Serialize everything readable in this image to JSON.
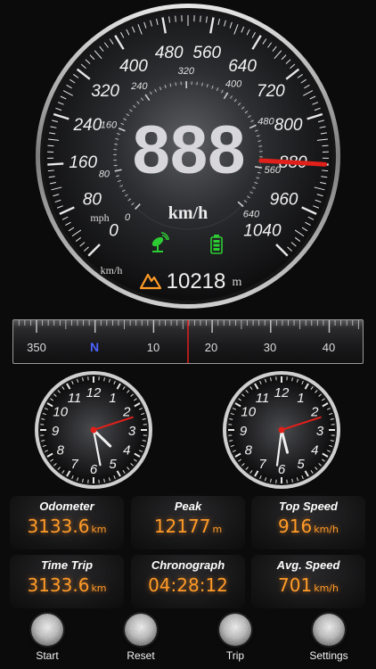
{
  "speedometer": {
    "kmh_ticks": [
      "0",
      "80",
      "160",
      "240",
      "320",
      "400",
      "480",
      "560",
      "640",
      "720",
      "800",
      "880",
      "960",
      "1040"
    ],
    "mph_ticks": [
      "0",
      "80",
      "160",
      "240",
      "320",
      "400",
      "480",
      "560",
      "640"
    ],
    "speed_value": "888",
    "speed_unit": "km/h",
    "needle_value_kmh": 880,
    "mph_label": "mph",
    "kmh_small_label": "km/h",
    "altitude_value": "10218",
    "altitude_unit": "m",
    "gps_icon": "satellite-dish-icon",
    "battery_icon": "battery-icon",
    "mountain_icon": "mountain-icon",
    "needle_color": "#e0201a",
    "gps_color": "#2ccc33",
    "battery_color": "#2ccc33",
    "mountain_color": "#ff9b28"
  },
  "compass": {
    "labels": [
      "350",
      "N",
      "10",
      "20",
      "30",
      "40"
    ],
    "north_color": "#4a63ff",
    "heading_marker_color": "#e0201a"
  },
  "clocks": {
    "numbers": [
      "12",
      "1",
      "2",
      "3",
      "4",
      "5",
      "6",
      "7",
      "8",
      "9",
      "10",
      "11"
    ],
    "left": {
      "hour": 4,
      "minute": 28,
      "second": 12
    },
    "right": {
      "hour": 5,
      "minute": 31,
      "second": 12
    }
  },
  "stats": {
    "odometer": {
      "label": "Odometer",
      "value": "3133.6",
      "unit": "km"
    },
    "peak": {
      "label": "Peak",
      "value": "12177",
      "unit": "m"
    },
    "top_speed": {
      "label": "Top Speed",
      "value": "916",
      "unit": "km/h"
    },
    "time_trip": {
      "label": "Time Trip",
      "value": "3133.6",
      "unit": "km"
    },
    "chronograph": {
      "label": "Chronograph",
      "value": "04:28:12"
    },
    "avg_speed": {
      "label": "Avg. Speed",
      "value": "701",
      "unit": "km/h"
    }
  },
  "buttons": {
    "start": "Start",
    "reset": "Reset",
    "trip": "Trip",
    "settings": "Settings"
  }
}
